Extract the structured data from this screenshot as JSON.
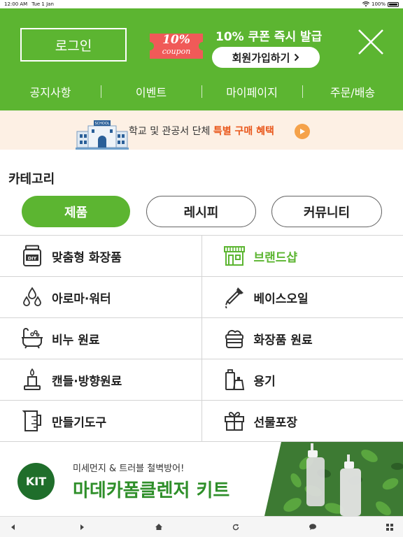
{
  "status_bar": {
    "time": "12:00 AM",
    "date": "Tue 1 Jan",
    "battery": "100%"
  },
  "header": {
    "login_label": "로그인",
    "coupon": {
      "percent": "10%",
      "word": "coupon"
    },
    "promo_title": "10% 쿠폰 즉시 발급",
    "signup_label": "회원가입하기",
    "nav": [
      "공지사항",
      "이벤트",
      "마이페이지",
      "주문/배송"
    ]
  },
  "banner": {
    "text_before": "학교 및 관공서 단체 ",
    "highlight": "특별 구매 혜택",
    "school_sign": "SCHOOL"
  },
  "category": {
    "title": "카테고리",
    "tabs": [
      {
        "label": "제품",
        "active": true
      },
      {
        "label": "레시피",
        "active": false
      },
      {
        "label": "커뮤니티",
        "active": false
      }
    ],
    "items": [
      {
        "label": "맞춤형 화장품",
        "icon": "diy-jar-icon"
      },
      {
        "label": "브랜드샵",
        "icon": "storefront-icon",
        "highlight": true
      },
      {
        "label": "아로마·워터",
        "icon": "droplets-icon"
      },
      {
        "label": "베이스오일",
        "icon": "dropper-icon"
      },
      {
        "label": "비누 원료",
        "icon": "bathtub-icon"
      },
      {
        "label": "화장품 원료",
        "icon": "cream-jar-icon"
      },
      {
        "label": "캔들·방향원료",
        "icon": "candle-icon"
      },
      {
        "label": "용기",
        "icon": "bottles-icon"
      },
      {
        "label": "만들기도구",
        "icon": "measuring-cup-icon"
      },
      {
        "label": "선물포장",
        "icon": "gift-icon"
      }
    ]
  },
  "kit_banner": {
    "badge": "KIT",
    "subtitle": "미세먼지 & 트러블 철벽방어!",
    "title": "마데카폼클렌저 키트"
  },
  "colors": {
    "brand_green": "#5cb531",
    "banner_bg": "#fdf0e4",
    "highlight_orange": "#e9571b",
    "kit_dark_green": "#1f6e2b"
  }
}
